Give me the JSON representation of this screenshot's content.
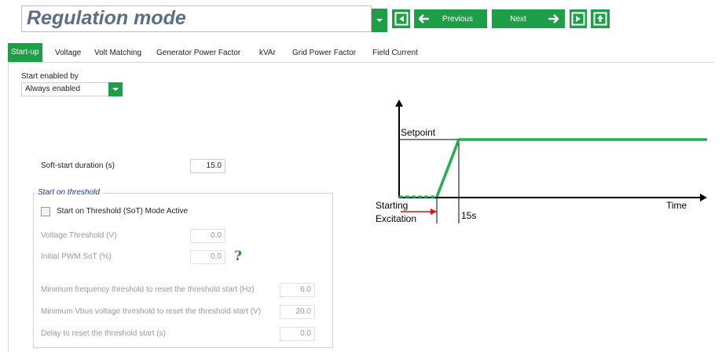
{
  "header": {
    "title": "Regulation mode",
    "previous_label": "Previous",
    "next_label": "Next"
  },
  "tabs": [
    {
      "label": "Start-up",
      "active": true
    },
    {
      "label": "Voltage"
    },
    {
      "label": "Volt Matching"
    },
    {
      "label": "Generator Power Factor"
    },
    {
      "label": "kVAr"
    },
    {
      "label": "Grid Power Factor"
    },
    {
      "label": "Field Current"
    }
  ],
  "form": {
    "start_enabled_label": "Start enabled by",
    "start_enabled_value": "Always enabled",
    "soft_start_label": "Soft-start duration (s)",
    "soft_start_value": "15.0",
    "threshold_group_title": "Start on threshold",
    "sot_checkbox_label": "Start on Threshold  (SoT) Mode Active",
    "voltage_threshold_label": "Voltage Threshold (V)",
    "voltage_threshold_value": "0.0",
    "initial_pwm_label": "Initial PWM SoT (%)",
    "initial_pwm_value": "0.0",
    "help_symbol": "?",
    "min_freq_label": "Minimum frequency threshold to reset the threshold start (Hz)",
    "min_freq_value": "6.0",
    "min_vbus_label": "Minimum Vbus voltage threshold to reset the threshold start (V)",
    "min_vbus_value": "20.0",
    "delay_label": "Delay to reset the threshold start (s)",
    "delay_value": "0.0"
  },
  "diagram": {
    "setpoint": "Setpoint",
    "time": "Time",
    "starting_line1": "Starting",
    "starting_line2": "Excitation",
    "ramp_time": "15s"
  },
  "colors": {
    "accent": "#1f9e48",
    "title_text": "#5a6f86",
    "group_title": "#1a3c9c",
    "arrow_red": "#e01010"
  },
  "icons": [
    "chevron-down-icon",
    "first-page-icon",
    "arrow-left-icon",
    "arrow-right-icon",
    "last-page-icon",
    "upload-icon"
  ]
}
